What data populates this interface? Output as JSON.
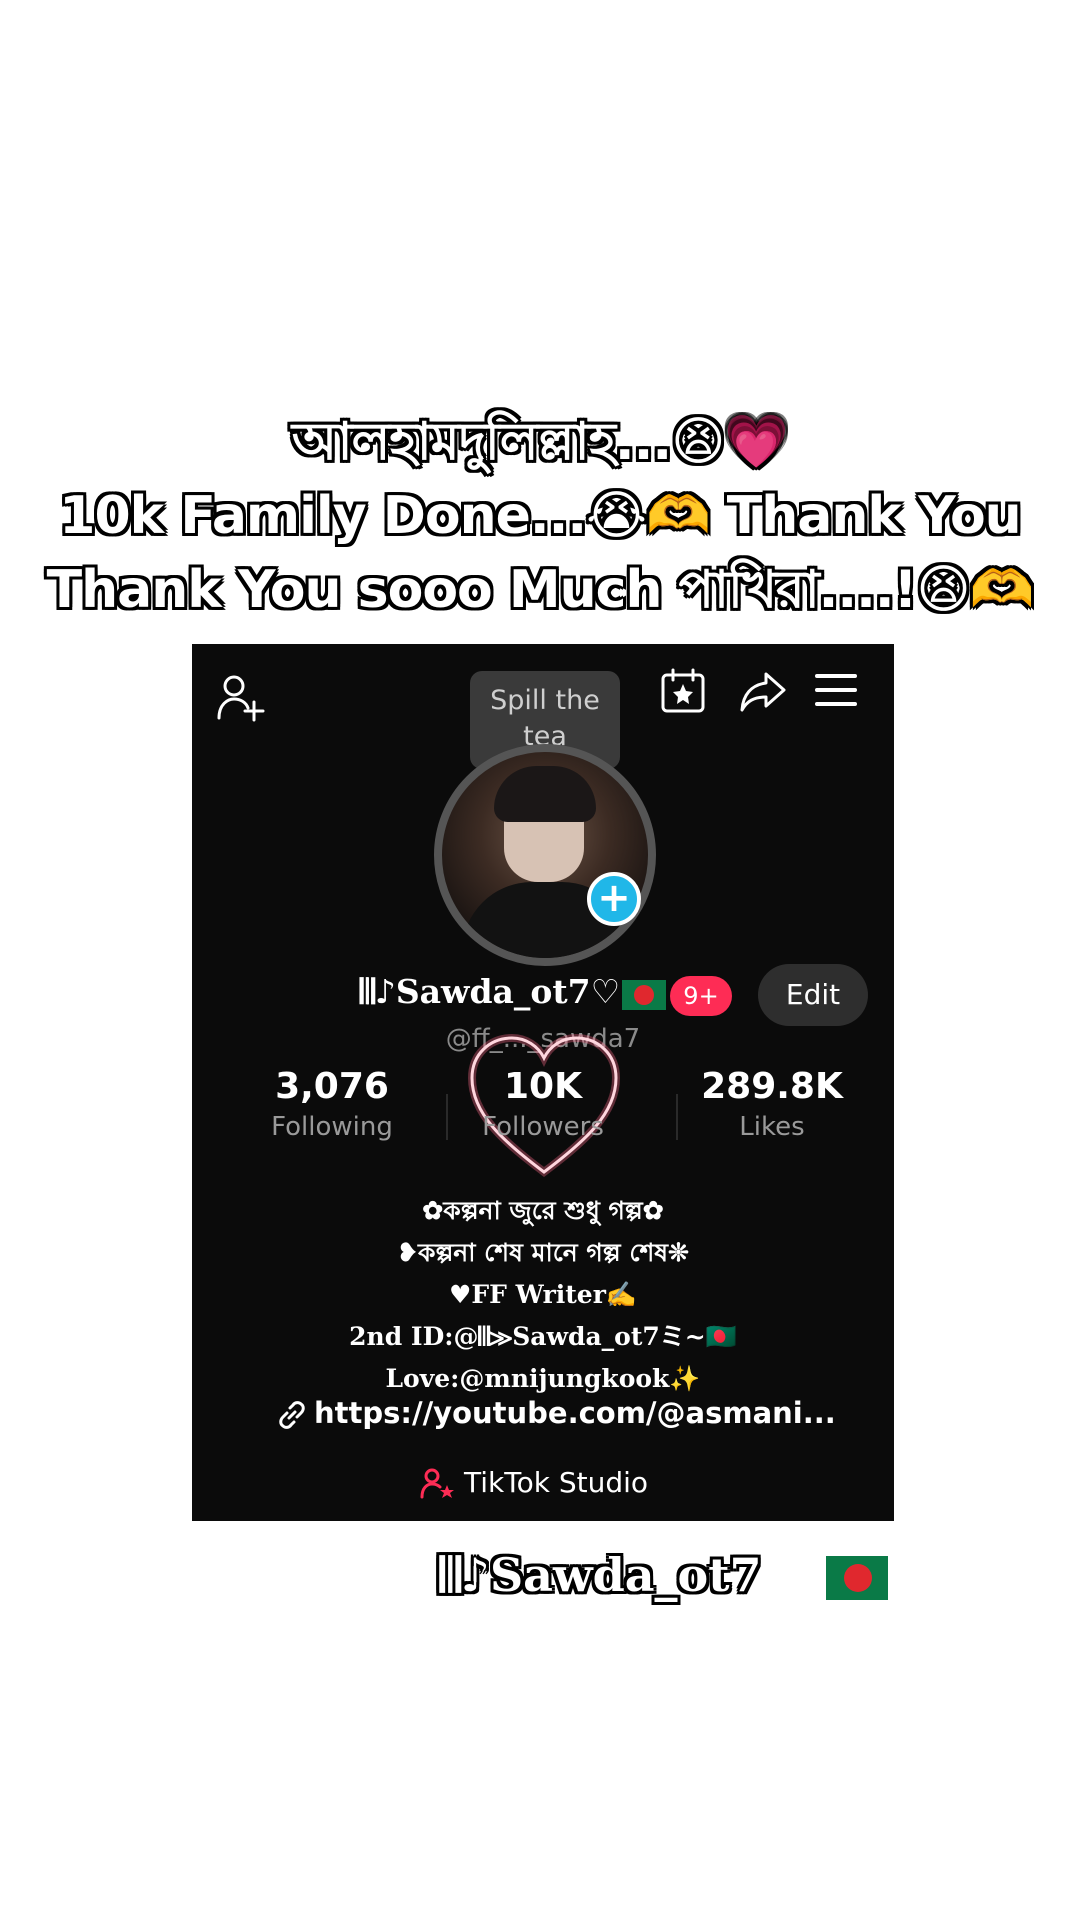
{
  "caption": {
    "line1": "আলহামদুলিল্লাহ...😫💗",
    "line2": "10k Family Done...😭🫶 Thank You",
    "line3": "Thank You sooo Much পাখিরা....!😫🫶"
  },
  "screenshot": {
    "icons": {
      "add_friend": "add-user-icon",
      "favorites": "calendar-star-icon",
      "share": "share-arrow-icon",
      "menu": "hamburger-menu-icon"
    },
    "tooltip": {
      "line1": "Spill the",
      "line2": "tea"
    },
    "profile": {
      "display_name": "𝄃𝄂♪Sawda_ot7♡",
      "badge": "9+",
      "edit_label": "Edit",
      "handle": "@ff_..._sawda7"
    },
    "stats": {
      "following": {
        "value": "3,076",
        "label": "Following"
      },
      "followers": {
        "value": "10K",
        "label": "Followers"
      },
      "likes": {
        "value": "289.8K",
        "label": "Likes"
      }
    },
    "bio": [
      "✿কল্পনা জুরে শুধু গল্প✿",
      "❥কল্পনা শেষ মানে গল্প শেষ❊",
      "♥FF Writer✍️",
      "2nd ID:@𝄃𝄂≫Sawda_ot7ミ~🇧🇩",
      "Love:@mnijungkook✨"
    ],
    "link": "https://youtube.com/@asmani...",
    "studio_label": "TikTok Studio"
  },
  "bottom_name": "𝄃𝄂♪Sawda_ot7"
}
